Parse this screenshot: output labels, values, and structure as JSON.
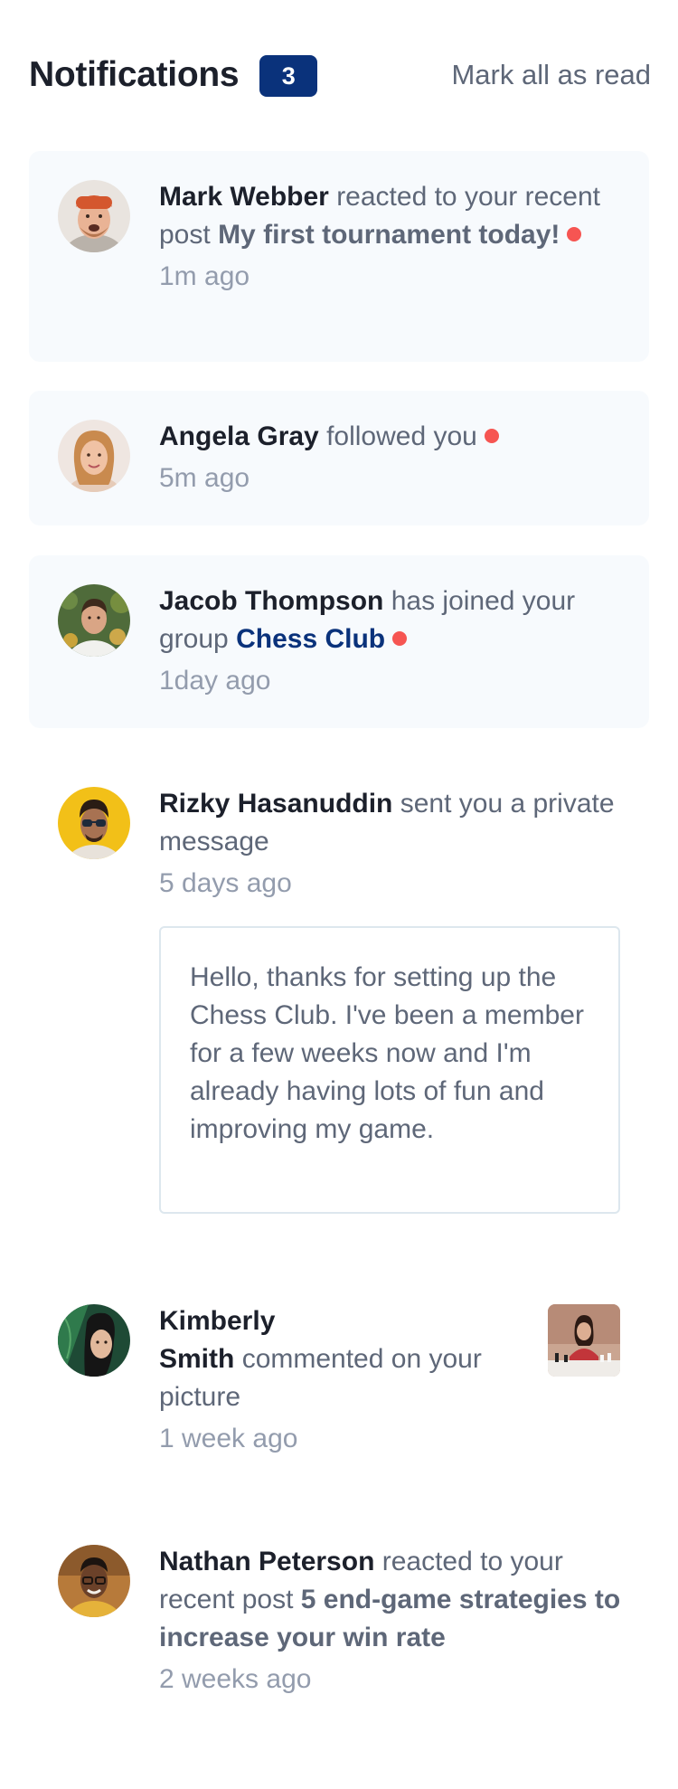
{
  "header": {
    "title": "Notifications",
    "unread_count": "3",
    "mark_all_label": "Mark all as read"
  },
  "colors": {
    "unread_bg": "#f7fafd",
    "badge": "#0a327b",
    "dot": "#f65552",
    "name": "#1c202b",
    "text": "#5e6778",
    "time": "#939cad"
  },
  "notifications": [
    {
      "name": "Mark Webber",
      "action": "reacted to your recent post",
      "target": "My first tournament today!",
      "time": "1m ago",
      "unread": true
    },
    {
      "name": "Angela Gray",
      "action": "followed you",
      "time": "5m ago",
      "unread": true
    },
    {
      "name": "Jacob Thompson",
      "action": "has joined your group",
      "target": "Chess Club",
      "time": "1day ago",
      "unread": true
    },
    {
      "name": "Rizky Hasanuddin",
      "action": "sent you a private message",
      "time": "5 days ago",
      "message": "Hello, thanks for setting up the Chess Club. I've been a member for a few weeks now and I'm already having lots of fun and improving my game.",
      "unread": false
    },
    {
      "name_line1": "Kimberly",
      "name_line2": "Smith",
      "action": "commented on your picture",
      "time": "1 week ago",
      "unread": false
    },
    {
      "name": "Nathan Peterson",
      "action": "reacted to your recent post",
      "target": "5 end-game strategies to increase your win rate",
      "time": "2 weeks ago",
      "unread": false
    }
  ]
}
